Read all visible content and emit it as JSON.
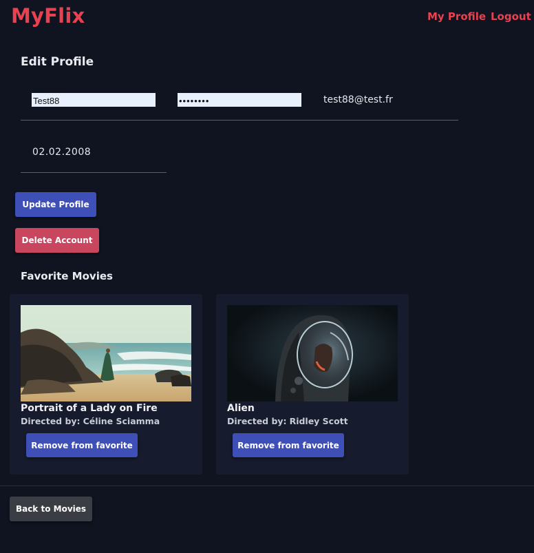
{
  "colors": {
    "brand": "#e8414f",
    "primary_button": "#3f4fb8",
    "danger_button": "#c9465f",
    "secondary_button": "#3b3d44"
  },
  "navbar": {
    "brand": "MyFlix",
    "links": [
      "My Profile",
      "Logout"
    ]
  },
  "edit_profile": {
    "title": "Edit Profile",
    "username_value": "Test88",
    "password_value": "••••••••",
    "email": "test88@test.fr",
    "birthday": "02.02.2008",
    "update_label": "Update Profile",
    "delete_label": "Delete Account"
  },
  "favorites": {
    "title": "Favorite Movies",
    "director_prefix": "Directed by:",
    "remove_label": "Remove from favorite",
    "movies": [
      {
        "title": "Portrait of a Lady on Fire",
        "director": "Céline Sciamma",
        "poster_icon": "beach-scene-image"
      },
      {
        "title": "Alien",
        "director": "Ridley Scott",
        "poster_icon": "astronaut-helmet-image"
      }
    ]
  },
  "footer": {
    "back_label": "Back to Movies"
  }
}
